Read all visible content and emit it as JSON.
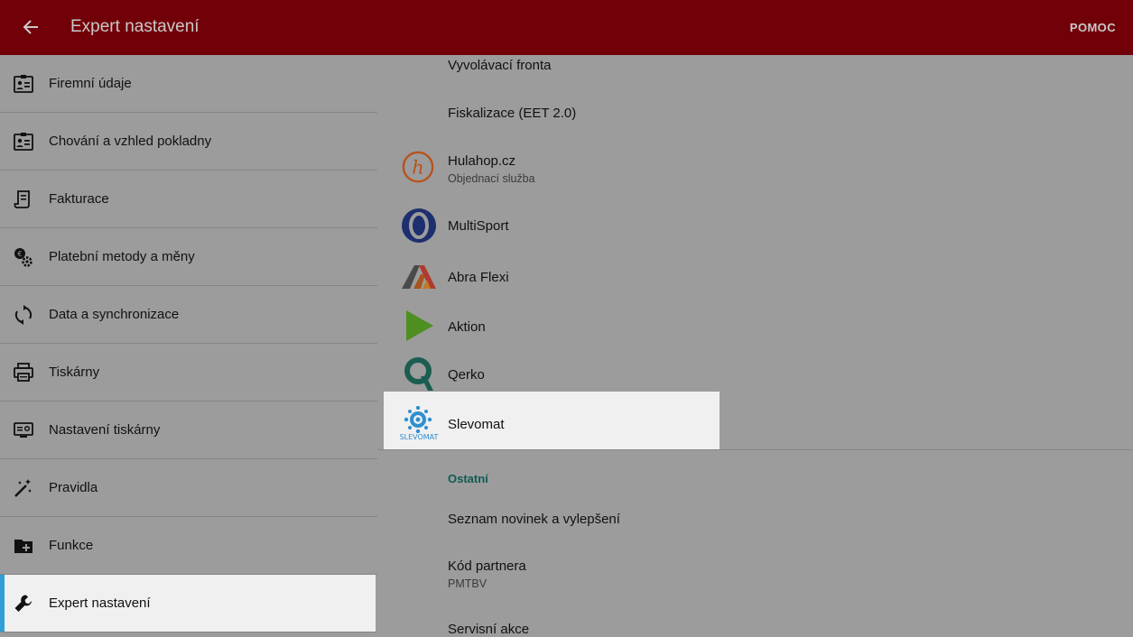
{
  "appbar": {
    "title": "Expert nastavení",
    "help": "POMOC"
  },
  "sidebar": {
    "items": [
      {
        "label": "Firemní údaje",
        "icon": "id-card-icon"
      },
      {
        "label": "Chování a vzhled pokladny",
        "icon": "id-card-icon"
      },
      {
        "label": "Fakturace",
        "icon": "invoice-icon"
      },
      {
        "label": "Platební metody a měny",
        "icon": "currency-gear-icon"
      },
      {
        "label": "Data a synchronizace",
        "icon": "sync-icon"
      },
      {
        "label": "Tiskárny",
        "icon": "printer-icon"
      },
      {
        "label": "Nastavení tiskárny",
        "icon": "printer-settings-icon"
      },
      {
        "label": "Pravidla",
        "icon": "magic-wand-icon"
      },
      {
        "label": "Funkce",
        "icon": "folder-plus-icon"
      },
      {
        "label": "Expert nastavení",
        "icon": "wrench-icon",
        "active": true
      }
    ]
  },
  "content": {
    "items": [
      {
        "title": "Vyvolávací fronta"
      },
      {
        "title": "Fiskalizace (EET 2.0)"
      },
      {
        "title": "Hulahop.cz",
        "subtitle": "Objednací služba",
        "icon": "hulahop-logo-icon"
      },
      {
        "title": "MultiSport",
        "icon": "multisport-logo-icon"
      },
      {
        "title": "Abra Flexi",
        "icon": "abra-flexi-logo-icon"
      },
      {
        "title": "Aktion",
        "icon": "aktion-logo-icon"
      },
      {
        "title": "Qerko",
        "icon": "qerko-logo-icon"
      },
      {
        "title": "Slevomat",
        "icon": "slevomat-logo-icon",
        "logo_text": "SLEVOMAT",
        "selected": true
      }
    ],
    "section_other": "Ostatní",
    "other_items": [
      {
        "title": "Seznam novinek a vylepšení"
      },
      {
        "title": "Kód partnera",
        "subtitle": "PMTBV"
      },
      {
        "title": "Servisní akce"
      }
    ]
  },
  "colors": {
    "appbar": "#720009",
    "overlay_bg": "#9c9c9c",
    "active_indicator": "#2f9fd6",
    "section_header": "#0d5c52"
  }
}
